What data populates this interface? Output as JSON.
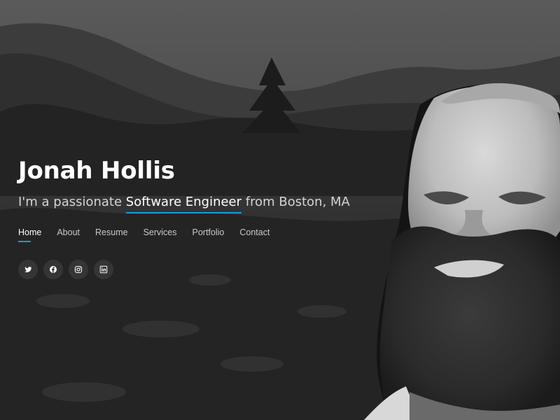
{
  "hero": {
    "name": "Jonah Hollis",
    "tagline_prefix": "I'm a passionate ",
    "tagline_highlight": "Software Engineer",
    "tagline_suffix": " from Boston, MA"
  },
  "nav": {
    "items": [
      {
        "label": "Home",
        "active": true
      },
      {
        "label": "About"
      },
      {
        "label": "Resume"
      },
      {
        "label": "Services"
      },
      {
        "label": "Portfolio"
      },
      {
        "label": "Contact"
      }
    ]
  },
  "social": [
    {
      "icon": "twitter-icon"
    },
    {
      "icon": "facebook-icon"
    },
    {
      "icon": "instagram-icon"
    },
    {
      "icon": "linkedin-icon"
    }
  ],
  "theme": {
    "accent": "#149ddd",
    "text": "#ffffff",
    "muted": "#c9c9c9"
  }
}
